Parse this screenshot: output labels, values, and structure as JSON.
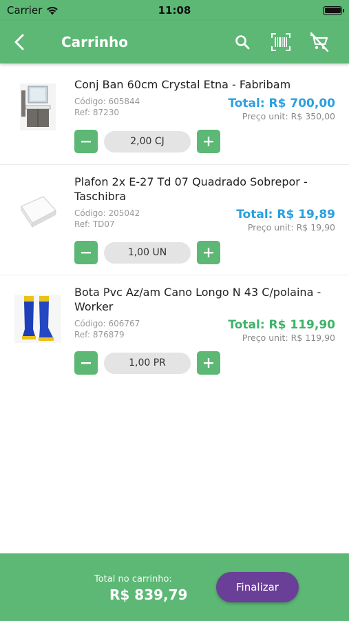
{
  "status_bar": {
    "carrier": "Carrier",
    "time": "11:08",
    "battery_level": 1.0
  },
  "nav": {
    "title": "Carrinho",
    "icons": [
      "back-icon",
      "search-icon",
      "barcode-icon",
      "clear-cart-icon"
    ]
  },
  "items": [
    {
      "name": "Conj Ban 60cm Crystal Etna - Fabribam",
      "code": "Código: 605844",
      "ref": "Ref: 87230",
      "total": "Total: R$ 700,00",
      "unit_price": "Preço unit: R$ 350,00",
      "quantity": "2,00 CJ",
      "total_color": "#2a9fe0",
      "image": "bathroom-cabinet"
    },
    {
      "name": "Plafon 2x E-27 Td 07 Quadrado Sobrepor - Taschibra",
      "code": "Código: 205042",
      "ref": "Ref: TD07",
      "total": "Total: R$ 19,89",
      "unit_price": "Preço unit: R$ 19,90",
      "quantity": "1,00 UN",
      "total_color": "#2a9fe0",
      "image": "ceiling-light"
    },
    {
      "name": "Bota Pvc Az/am Cano Longo N 43 C/polaina - Worker",
      "code": "Código: 606767",
      "ref": "Ref: 876879",
      "total": "Total: R$ 119,90",
      "unit_price": "Preço unit: R$ 119,90",
      "quantity": "1,00 PR",
      "total_color": "#3db36a",
      "image": "rubber-boots"
    }
  ],
  "footer": {
    "label": "Total no carrinho:",
    "value": "R$ 839,79",
    "button": "Finalizar"
  },
  "colors": {
    "primary": "#5cb874",
    "finalize": "#6a3f97",
    "total_blue": "#2a9fe0",
    "total_green": "#3db36a"
  }
}
